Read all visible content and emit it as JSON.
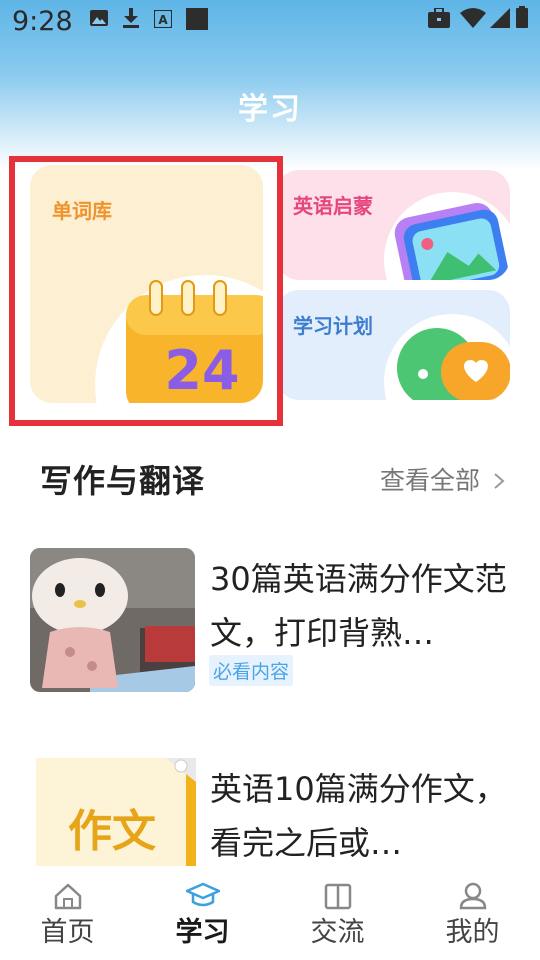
{
  "status_bar": {
    "time": "9:28",
    "left_icons": [
      "image-icon",
      "download-icon",
      "text-a-icon",
      "square-icon"
    ],
    "right_icons": [
      "briefcase-icon",
      "wifi-icon",
      "signal-icon",
      "battery-icon"
    ]
  },
  "header": {
    "title": "学习"
  },
  "cards": {
    "vocab": {
      "label": "单词库",
      "calendar_number": "24",
      "label_color": "#f0932b"
    },
    "kids": {
      "label": "英语启蒙",
      "label_color": "#e6457d"
    },
    "plan": {
      "label": "学习计划",
      "label_color": "#3d7dd0"
    }
  },
  "section": {
    "title": "写作与翻译",
    "see_all": "查看全部",
    "see_all_icon": "chevron-right-icon"
  },
  "articles": [
    {
      "title": "30篇英语满分作文范文，打印背熟…",
      "tag": "必看内容"
    },
    {
      "title": "英语10篇满分作文，看完之后或…",
      "thumb_text": "作文"
    }
  ],
  "bottom_nav": [
    {
      "label": "首页",
      "icon": "home-icon",
      "active": false
    },
    {
      "label": "学习",
      "icon": "graduation-cap-icon",
      "active": true
    },
    {
      "label": "交流",
      "icon": "book-icon",
      "active": false
    },
    {
      "label": "我的",
      "icon": "user-icon",
      "active": false
    }
  ],
  "colors": {
    "header_blue": "#5eb5e6",
    "highlight_red": "#e5323a",
    "active_icon": "#3aa0e0",
    "tag_blue": "#4aa4e8"
  }
}
